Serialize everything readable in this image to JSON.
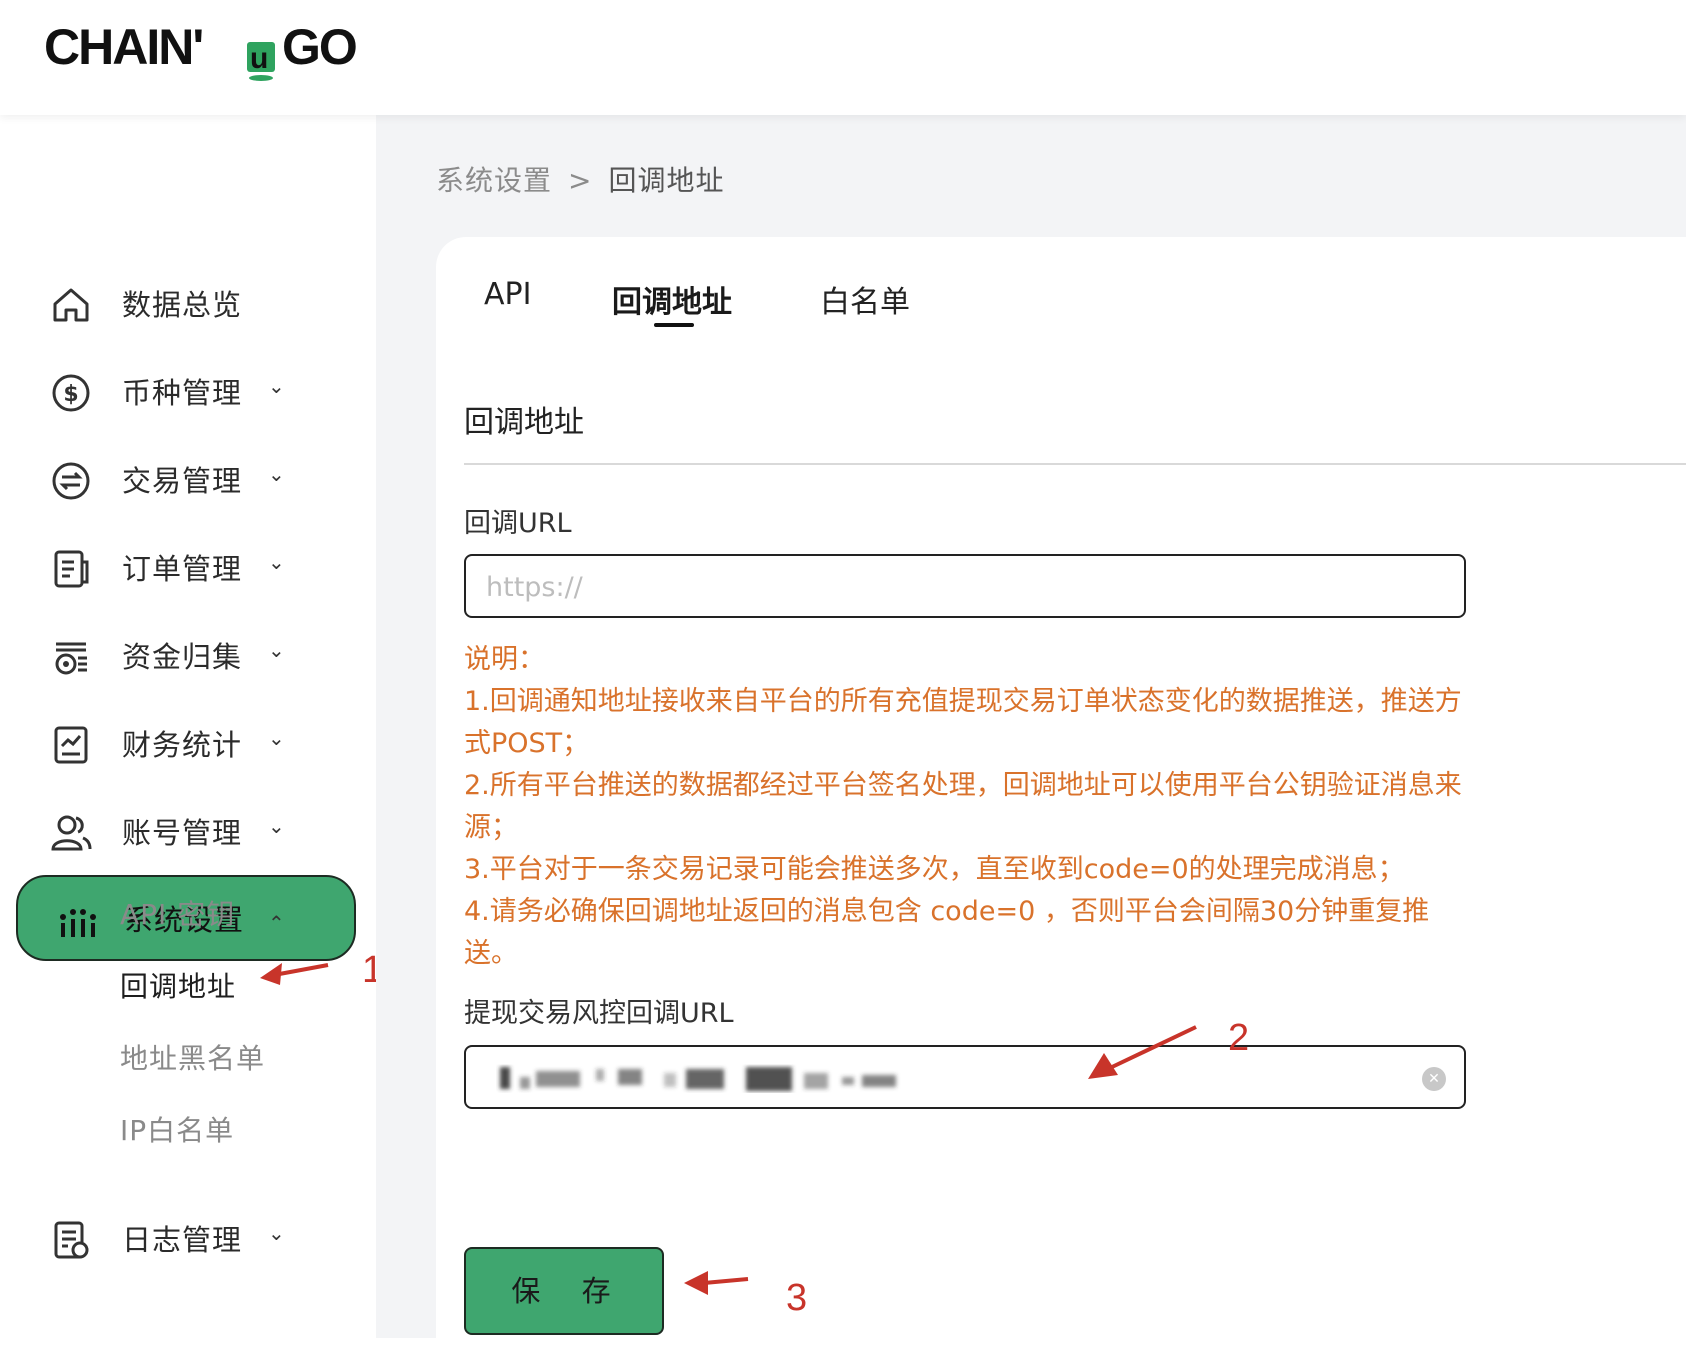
{
  "header": {
    "logo_text": "CHAIN'uGO"
  },
  "sidebar": {
    "items": [
      {
        "label": "数据总览",
        "icon": "home-icon",
        "chevron": ""
      },
      {
        "label": "币种管理",
        "icon": "dollar-circle-icon",
        "chevron": "⌄"
      },
      {
        "label": "交易管理",
        "icon": "exchange-circle-icon",
        "chevron": "⌄"
      },
      {
        "label": "订单管理",
        "icon": "document-icon",
        "chevron": "⌄"
      },
      {
        "label": "资金归集",
        "icon": "fund-collection-icon",
        "chevron": "⌄"
      },
      {
        "label": "财务统计",
        "icon": "report-chart-icon",
        "chevron": "⌄"
      },
      {
        "label": "账号管理",
        "icon": "users-icon",
        "chevron": "⌄"
      },
      {
        "label": "系统设置",
        "icon": "settings-bars-icon",
        "chevron": "⌃"
      },
      {
        "label": "日志管理",
        "icon": "log-icon",
        "chevron": "⌄"
      }
    ],
    "sub_items": [
      "API 密钥",
      "回调地址",
      "地址黑名单",
      "IP白名单"
    ]
  },
  "breadcrumb": {
    "parent": "系统设置",
    "separator": ">",
    "current": "回调地址"
  },
  "tabs": [
    "API",
    "回调地址",
    "白名单"
  ],
  "section_title": "回调地址",
  "callback_url": {
    "label": "回调URL",
    "placeholder": "https://",
    "value": ""
  },
  "notes": [
    "说明：",
    "1.回调通知地址接收来自平台的所有充值提现交易订单状态变化的数据推送，推送方式POST；",
    "2.所有平台推送的数据都经过平台签名处理，回调地址可以使用平台公钥验证消息来源；",
    "3.平台对于一条交易记录可能会推送多次，直至收到code=0的处理完成消息；",
    "4.请务必确保回调地址返回的消息包含 code=0 ，否则平台会间隔30分钟重复推送。"
  ],
  "risk_url": {
    "label": "提现交易风控回调URL"
  },
  "save_label": "保 存",
  "annotations": [
    "1",
    "2",
    "3"
  ],
  "colors": {
    "accent_green": "#3fa66f",
    "note_orange": "#d9722b",
    "annotation_red": "#c8342a"
  }
}
